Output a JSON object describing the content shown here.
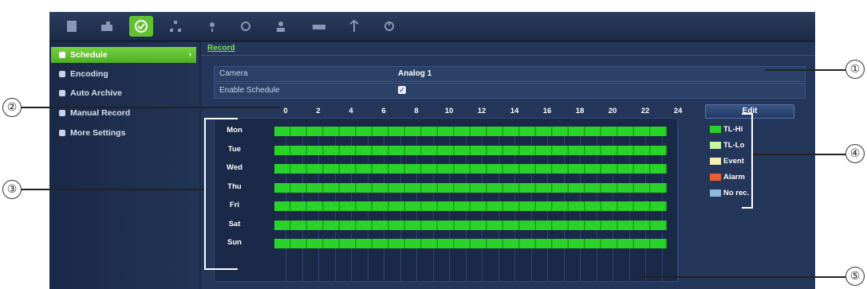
{
  "toolbar": {
    "icons": [
      "monitor-icon",
      "camera-settings-icon",
      "record-icon",
      "network-icon",
      "alarm-icon",
      "device-icon",
      "user-icon",
      "hdd-icon",
      "system-info-icon",
      "shutdown-icon"
    ],
    "active_index": 2
  },
  "sidebar": {
    "items": [
      {
        "label": "Schedule",
        "active": true
      },
      {
        "label": "Encoding",
        "active": false
      },
      {
        "label": "Auto Archive",
        "active": false
      },
      {
        "label": "Manual Record",
        "active": false
      },
      {
        "label": "More Settings",
        "active": false
      }
    ]
  },
  "main": {
    "tab": "Record",
    "camera_label": "Camera",
    "camera_value": "Analog 1",
    "enable_label": "Enable Schedule",
    "enable_checked": true,
    "enable_check_glyph": "✓"
  },
  "schedule": {
    "hours": [
      "0",
      "2",
      "4",
      "6",
      "8",
      "10",
      "12",
      "14",
      "16",
      "18",
      "20",
      "22",
      "24"
    ],
    "days": [
      "Mon",
      "Tue",
      "Wed",
      "Thu",
      "Fri",
      "Sat",
      "Sun"
    ],
    "fill_color": "#2ad32a",
    "coverage": "0-24 all days (TL-Hi)"
  },
  "edit_button": "Edit",
  "legend": [
    {
      "label": "TL-Hi",
      "color": "#2bcf2b"
    },
    {
      "label": "TL-Lo",
      "color": "#c9f5a5"
    },
    {
      "label": "Event",
      "color": "#f4f0b8"
    },
    {
      "label": "Alarm",
      "color": "#e8602f"
    },
    {
      "label": "No rec.",
      "color": "#8fb9dc"
    }
  ],
  "callouts": [
    "①",
    "②",
    "③",
    "④",
    "⑤"
  ]
}
